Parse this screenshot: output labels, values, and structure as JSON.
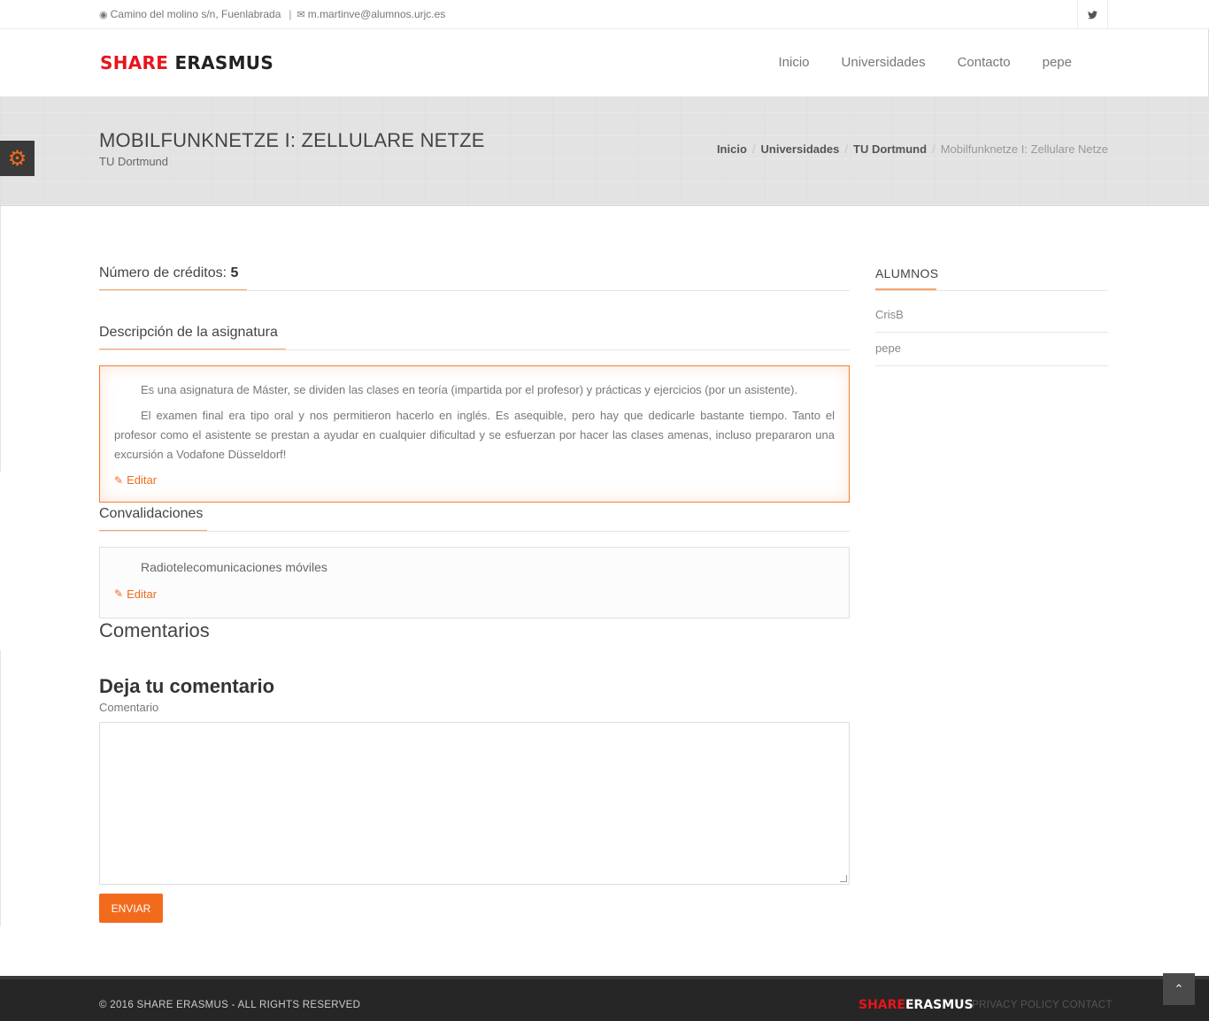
{
  "topbar": {
    "address": "Camino del molino s/n, Fuenlabrada",
    "email": "m.martinve@alumnos.urjc.es",
    "social_icon": "twitter-icon"
  },
  "header": {
    "logo_part1": "SHARE",
    "logo_part2": "ERASMUS",
    "nav": [
      "Inicio",
      "Universidades",
      "Contacto",
      "pepe"
    ]
  },
  "page": {
    "title": "MOBILFUNKNETZE I: ZELLULARE NETZE",
    "subtitle": "TU Dortmund",
    "breadcrumb": [
      "Inicio",
      "Universidades",
      "TU Dortmund"
    ],
    "breadcrumb_current": "Mobilfunknetze I: Zellulare Netze"
  },
  "credits": {
    "label": "Número de créditos:",
    "value": "5"
  },
  "description": {
    "heading": "Descripción de la asignatura",
    "paragraphs": [
      "Es una asignatura de Máster, se dividen las clases en teoría (impartida por el profesor) y prácticas y ejercicios (por un asistente).",
      "El examen final era tipo oral y nos permitieron hacerlo en inglés. Es asequible, pero hay que dedicarle bastante tiempo. Tanto el profesor como el asistente se prestan a ayudar en cualquier dificultad y se esfuerzan por hacer las clases amenas, incluso prepararon una excursión a Vodafone Düsseldorf!"
    ],
    "edit_label": "Editar"
  },
  "convalidaciones": {
    "heading": "Convalidaciones",
    "text": "Radiotelecomunicaciones móviles",
    "edit_label": "Editar"
  },
  "comments": {
    "heading": "Comentarios",
    "form_heading": "Deja tu comentario",
    "field_label": "Comentario",
    "submit_label": "ENVIAR"
  },
  "sidebar": {
    "title": "ALUMNOS",
    "students": [
      "CrisB",
      "pepe"
    ]
  },
  "footer": {
    "copyright": "© 2016 SHARE ERASMUS - ALL RIGHTS RESERVED",
    "logo_part1": "SHARE",
    "logo_part2": "ERASMUS",
    "links": [
      "PRIVACY POLICY",
      "CONTACT"
    ]
  },
  "colors": {
    "accent": "#f26b1d",
    "brand_red": "#e8141c",
    "footer_bg": "#262626"
  }
}
